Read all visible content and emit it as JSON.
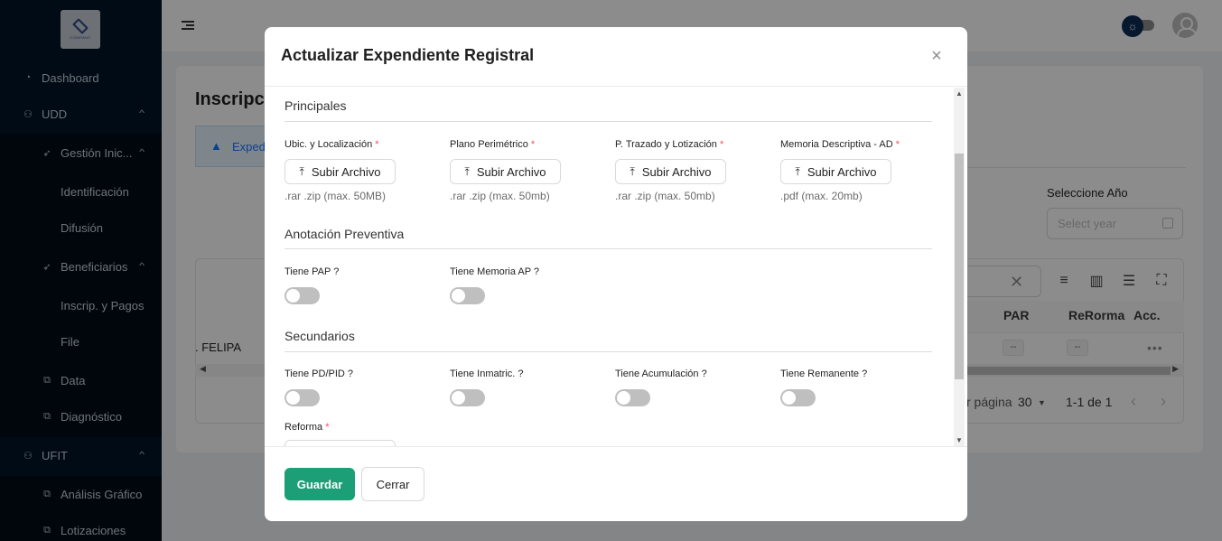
{
  "sidebar": {
    "logo_text": "COMPANY",
    "items": [
      {
        "label": "Dashboard",
        "icon": "dashboard-icon"
      },
      {
        "label": "UDD",
        "icon": "user-icon"
      },
      {
        "label": "Gestión Inic...",
        "icon": "rocket-icon"
      },
      {
        "label": "Identificación"
      },
      {
        "label": "Difusión"
      },
      {
        "label": "Beneficiarios",
        "icon": "rocket-icon"
      },
      {
        "label": "Inscrip. y Pagos"
      },
      {
        "label": "File"
      },
      {
        "label": "Data",
        "icon": "copy-icon"
      },
      {
        "label": "Diagnóstico",
        "icon": "copy-icon"
      },
      {
        "label": "UFIT",
        "icon": "user-icon"
      },
      {
        "label": "Análisis Gráfico",
        "icon": "copy-icon"
      },
      {
        "label": "Lotizaciones",
        "icon": "copy-icon"
      }
    ]
  },
  "background": {
    "page_title": "Inscripci",
    "alert_text": "Expedi",
    "year_label": "Seleccione Año",
    "year_placeholder": "Select year",
    "columns": [
      "PAR",
      "ReRorma",
      "Acc."
    ],
    "row_name": ". FELIPA",
    "row_values": [
      "--",
      "--"
    ],
    "more": "•••",
    "pager": {
      "per_page_label": "r página",
      "per_page": "30",
      "range": "1-1 de 1"
    }
  },
  "modal": {
    "title": "Actualizar Expendiente Registral",
    "sections": {
      "principales": "Principales",
      "anotacion": "Anotación Preventiva",
      "secundarios": "Secundarios"
    },
    "uploads": [
      {
        "label": "Ubic. y Localización",
        "button": "Subir Archivo",
        "hint": ".rar .zip (max. 50MB)"
      },
      {
        "label": "Plano Perimétrico",
        "button": "Subir Archivo",
        "hint": ".rar .zip (max. 50mb)"
      },
      {
        "label": "P. Trazado y Lotización",
        "button": "Subir Archivo",
        "hint": ".rar .zip (max. 50mb)"
      },
      {
        "label": "Memoria Descriptiva - AD",
        "button": "Subir Archivo",
        "hint": ".pdf (max. 20mb)"
      }
    ],
    "anotacion_toggles": [
      {
        "label": "Tiene PAP ?",
        "on": false
      },
      {
        "label": "Tiene Memoria AP ?",
        "on": false
      }
    ],
    "secundarios_toggles": [
      {
        "label": "Tiene PD/PID ?",
        "on": false
      },
      {
        "label": "Tiene Inmatric. ?",
        "on": false
      },
      {
        "label": "Tiene Acumulación ?",
        "on": false
      },
      {
        "label": "Tiene Remanente ?",
        "on": false
      }
    ],
    "reforma_label": "Reforma",
    "required_mark": "*",
    "save_label": "Guardar",
    "close_label": "Cerrar"
  }
}
